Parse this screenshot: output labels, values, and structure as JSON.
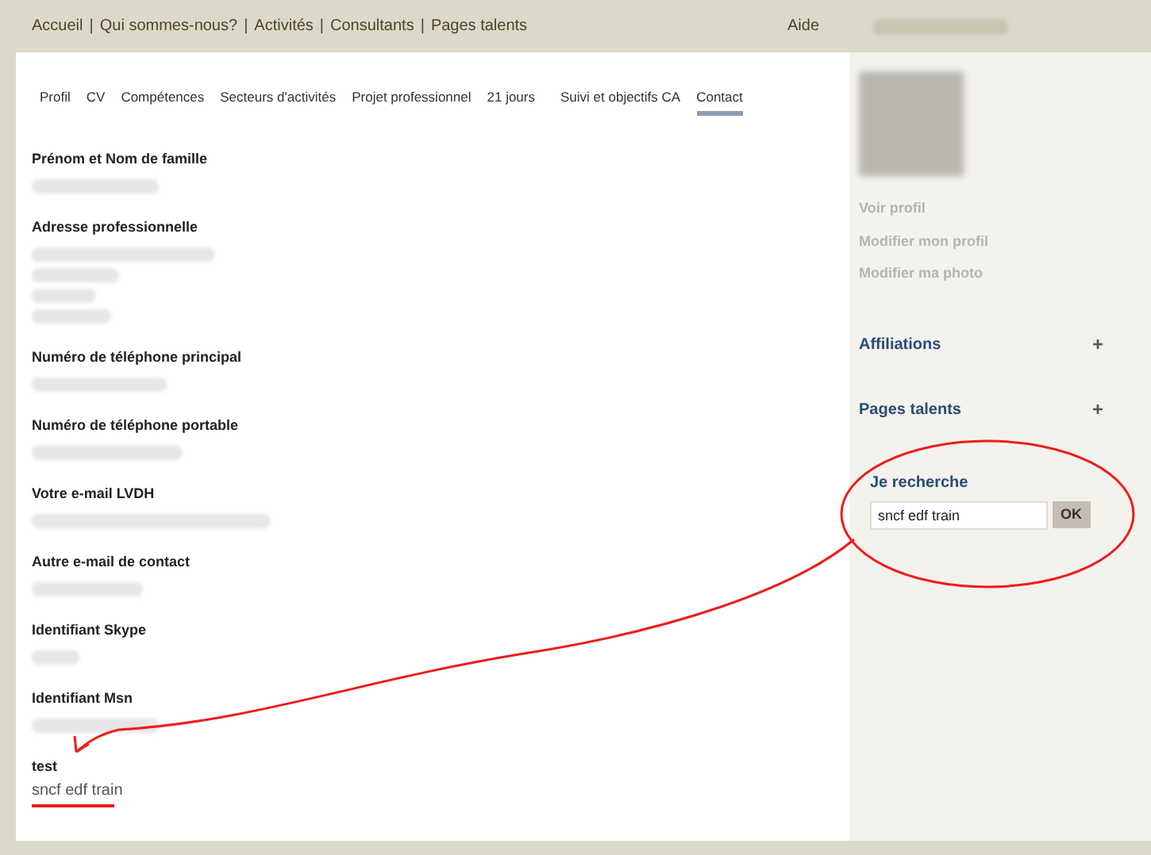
{
  "top_nav": {
    "links": [
      "Accueil",
      "Qui sommes-nous?",
      "Activités",
      "Consultants",
      "Pages talents"
    ],
    "separator": "|",
    "help": "Aide"
  },
  "tabs": [
    {
      "label": "Profil",
      "selected": false
    },
    {
      "label": "CV",
      "selected": false
    },
    {
      "label": "Compétences",
      "selected": false
    },
    {
      "label": "Secteurs d'activités",
      "selected": false
    },
    {
      "label": "Projet professionnel",
      "selected": false
    },
    {
      "label": "21 jours",
      "selected": false
    },
    {
      "label": "Suivi et objectifs CA",
      "selected": false
    },
    {
      "label": "Contact",
      "selected": true
    }
  ],
  "fields": [
    {
      "label": "Prénom et Nom de famille",
      "values": [
        {
          "kind": "blurred"
        }
      ]
    },
    {
      "label": "Adresse professionnelle",
      "values": [
        {
          "kind": "blurred"
        },
        {
          "kind": "blurred"
        },
        {
          "kind": "blurred"
        },
        {
          "kind": "blurred"
        }
      ]
    },
    {
      "label": "Numéro de téléphone principal",
      "values": [
        {
          "kind": "blurred"
        }
      ]
    },
    {
      "label": "Numéro de téléphone portable",
      "values": [
        {
          "kind": "blurred"
        }
      ]
    },
    {
      "label": "Votre e-mail LVDH",
      "values": [
        {
          "kind": "blurred"
        }
      ]
    },
    {
      "label": "Autre e-mail de contact",
      "values": [
        {
          "kind": "blurred"
        }
      ]
    },
    {
      "label": "Identifiant Skype",
      "values": [
        {
          "kind": "blurred"
        }
      ]
    },
    {
      "label": "Identifiant Msn",
      "values": [
        {
          "kind": "blurred"
        }
      ]
    },
    {
      "label": "test",
      "values": [
        {
          "kind": "text",
          "text": "sncf edf train"
        }
      ]
    }
  ],
  "sidebar": {
    "links": [
      "Voir profil",
      "Modifier mon profil",
      "Modifier ma photo"
    ],
    "sections": [
      {
        "title": "Affiliations",
        "expand": "+"
      },
      {
        "title": "Pages talents",
        "expand": "+"
      }
    ],
    "search": {
      "title": "Je recherche",
      "value": "sncf edf train",
      "button": "OK"
    }
  }
}
